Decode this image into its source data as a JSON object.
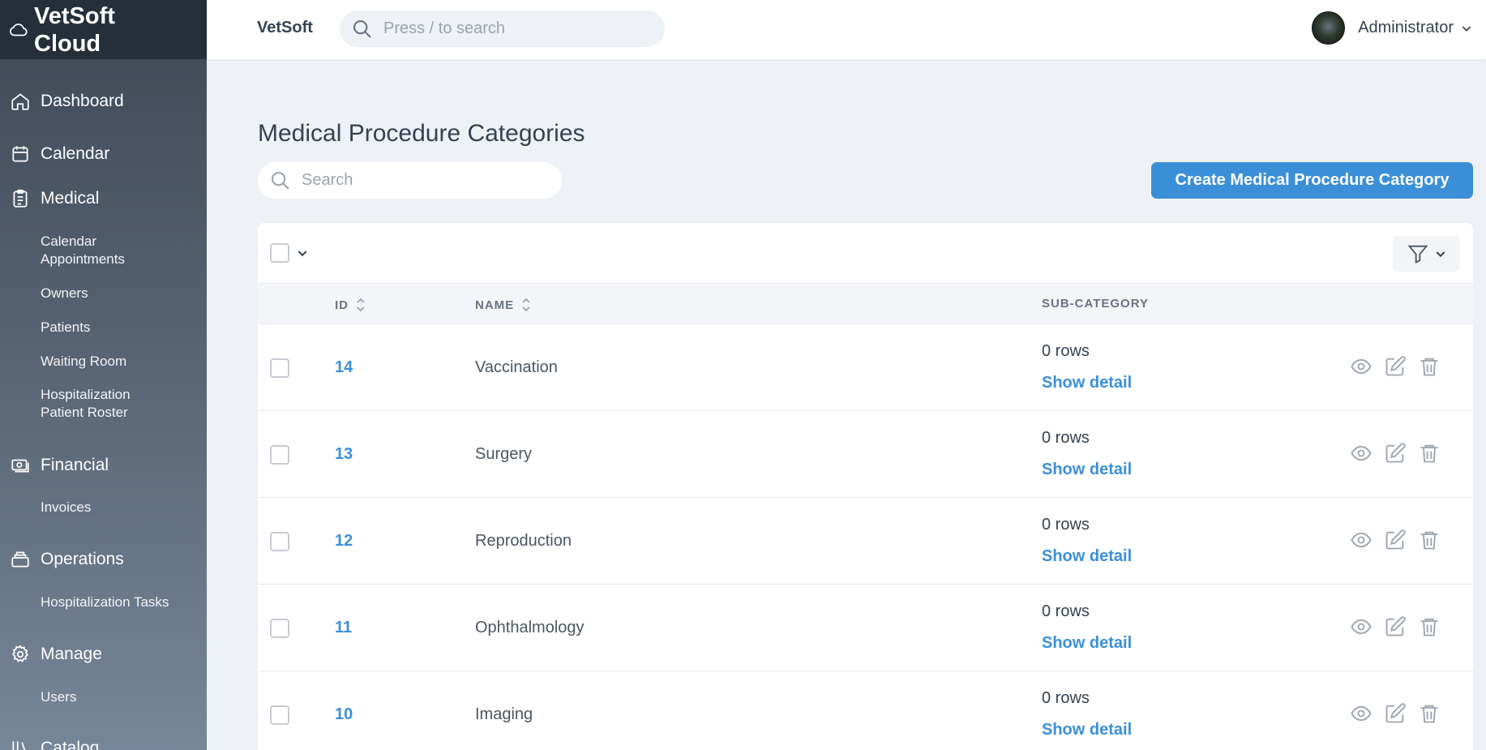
{
  "app": {
    "brand_line1": "VetSoft",
    "brand_line2": "Cloud",
    "top_brand": "VetSoft"
  },
  "top_search": {
    "placeholder": "Press / to search"
  },
  "user": {
    "name": "Administrator"
  },
  "sidebar": {
    "sections": [
      {
        "label": "Dashboard",
        "icon": "home-icon"
      },
      {
        "label": "Calendar",
        "icon": "calendar-icon"
      },
      {
        "label": "Medical",
        "icon": "clipboard-icon"
      },
      {
        "label": "Financial",
        "icon": "cash-icon"
      },
      {
        "label": "Operations",
        "icon": "inbox-icon"
      },
      {
        "label": "Manage",
        "icon": "gear-icon"
      },
      {
        "label": "Catalog",
        "icon": "library-icon"
      }
    ],
    "medical_items": [
      {
        "line1": "Calendar",
        "line2": "Appointments"
      },
      {
        "line1": "Owners"
      },
      {
        "line1": "Patients"
      },
      {
        "line1": "Waiting Room"
      },
      {
        "line1": "Hospitalization",
        "line2": "Patient Roster"
      }
    ],
    "financial_items": [
      {
        "line1": "Invoices"
      }
    ],
    "operations_items": [
      {
        "line1": "Hospitalization Tasks"
      }
    ],
    "manage_items": [
      {
        "line1": "Users"
      }
    ]
  },
  "main": {
    "title": "Medical Procedure Categories",
    "search_placeholder": "Search",
    "create_label": "Create Medical Procedure Category",
    "columns": {
      "id": "ID",
      "name": "NAME",
      "sub": "SUB-CATEGORY"
    },
    "rows": [
      {
        "id": "14",
        "name": "Vaccination",
        "sub": "0 rows",
        "detail": "Show detail"
      },
      {
        "id": "13",
        "name": "Surgery",
        "sub": "0 rows",
        "detail": "Show detail"
      },
      {
        "id": "12",
        "name": "Reproduction",
        "sub": "0 rows",
        "detail": "Show detail"
      },
      {
        "id": "11",
        "name": "Ophthalmology",
        "sub": "0 rows",
        "detail": "Show detail"
      },
      {
        "id": "10",
        "name": "Imaging",
        "sub": "0 rows",
        "detail": "Show detail"
      }
    ]
  },
  "colors": {
    "accent": "#3b8fd9",
    "sidebar_dark": "#252f3a"
  }
}
